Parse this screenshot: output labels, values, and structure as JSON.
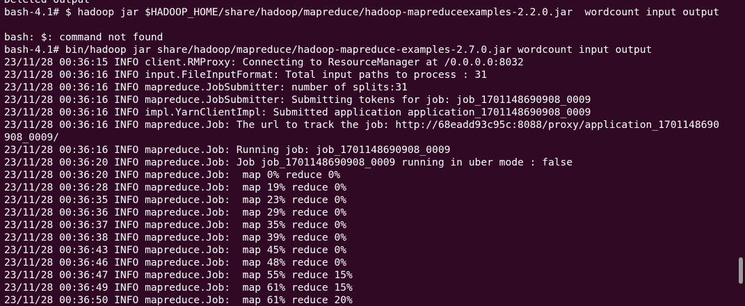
{
  "terminal": {
    "lines": [
      "Deleted output",
      "bash-4.1# $ hadoop jar $HADOOP_HOME/share/hadoop/mapreduce/hadoop-mapreduceexamples-2.2.0.jar  wordcount input output",
      "",
      "bash: $: command not found",
      "bash-4.1# bin/hadoop jar share/hadoop/mapreduce/hadoop-mapreduce-examples-2.7.0.jar wordcount input output",
      "23/11/28 00:36:15 INFO client.RMProxy: Connecting to ResourceManager at /0.0.0.0:8032",
      "23/11/28 00:36:16 INFO input.FileInputFormat: Total input paths to process : 31",
      "23/11/28 00:36:16 INFO mapreduce.JobSubmitter: number of splits:31",
      "23/11/28 00:36:16 INFO mapreduce.JobSubmitter: Submitting tokens for job: job_1701148690908_0009",
      "23/11/28 00:36:16 INFO impl.YarnClientImpl: Submitted application application_1701148690908_0009",
      "23/11/28 00:36:16 INFO mapreduce.Job: The url to track the job: http://68eadd93c95c:8088/proxy/application_1701148690",
      "908_0009/",
      "23/11/28 00:36:16 INFO mapreduce.Job: Running job: job_1701148690908_0009",
      "23/11/28 00:36:20 INFO mapreduce.Job: Job job_1701148690908_0009 running in uber mode : false",
      "23/11/28 00:36:20 INFO mapreduce.Job:  map 0% reduce 0%",
      "23/11/28 00:36:28 INFO mapreduce.Job:  map 19% reduce 0%",
      "23/11/28 00:36:35 INFO mapreduce.Job:  map 23% reduce 0%",
      "23/11/28 00:36:36 INFO mapreduce.Job:  map 29% reduce 0%",
      "23/11/28 00:36:37 INFO mapreduce.Job:  map 35% reduce 0%",
      "23/11/28 00:36:38 INFO mapreduce.Job:  map 39% reduce 0%",
      "23/11/28 00:36:43 INFO mapreduce.Job:  map 45% reduce 0%",
      "23/11/28 00:36:46 INFO mapreduce.Job:  map 48% reduce 0%",
      "23/11/28 00:36:47 INFO mapreduce.Job:  map 55% reduce 15%",
      "23/11/28 00:36:49 INFO mapreduce.Job:  map 61% reduce 15%",
      "23/11/28 00:36:50 INFO mapreduce.Job:  map 61% reduce 20%"
    ]
  },
  "colors": {
    "background": "#300a24",
    "foreground": "#ffffff",
    "scrollbar_thumb": "#9c9c9c"
  }
}
